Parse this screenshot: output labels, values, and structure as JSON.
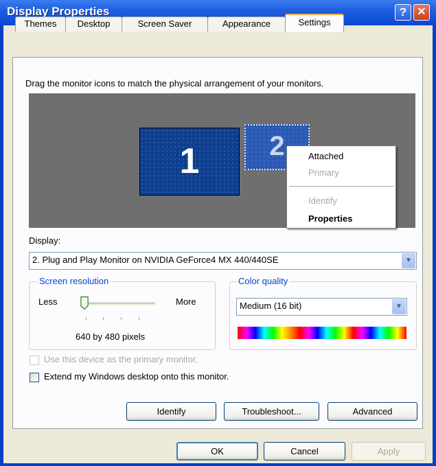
{
  "window": {
    "title": "Display Properties",
    "help_glyph": "?",
    "close_glyph": "✕"
  },
  "tabs": [
    {
      "label": "Themes"
    },
    {
      "label": "Desktop"
    },
    {
      "label": "Screen Saver"
    },
    {
      "label": "Appearance"
    },
    {
      "label": "Settings",
      "active": true
    }
  ],
  "settings": {
    "instruction": "Drag the monitor icons to match the physical arrangement of your monitors.",
    "monitors": [
      {
        "number": "1"
      },
      {
        "number": "2",
        "selected": true
      }
    ],
    "context_menu": {
      "items": [
        {
          "label": "Attached",
          "state": "enabled"
        },
        {
          "label": "Primary",
          "state": "disabled"
        },
        {
          "label": "Identify",
          "state": "disabled"
        },
        {
          "label": "Properties",
          "state": "bold"
        }
      ]
    },
    "display_label": "Display:",
    "display_value": "2. Plug and Play Monitor on NVIDIA GeForce4 MX 440/440SE",
    "screen_resolution": {
      "label": "Screen resolution",
      "less": "Less",
      "more": "More",
      "value": "640 by 480 pixels",
      "slider_position": 0
    },
    "color_quality": {
      "label": "Color quality",
      "value": "Medium (16 bit)"
    },
    "checkboxes": [
      {
        "label": "Use this device as the primary monitor.",
        "checked": false,
        "enabled": false
      },
      {
        "label": "Extend my Windows desktop onto this monitor.",
        "checked": false,
        "enabled": true
      }
    ],
    "buttons": {
      "identify": "Identify",
      "troubleshoot": "Troubleshoot...",
      "advanced": "Advanced"
    }
  },
  "footer": {
    "ok": "OK",
    "cancel": "Cancel",
    "apply": "Apply"
  },
  "colors": {
    "titlebar": "#0b47d4",
    "dialog_bg": "#ece9d8",
    "active_tab_accent": "#f3b43d",
    "group_label": "#0046d5"
  }
}
